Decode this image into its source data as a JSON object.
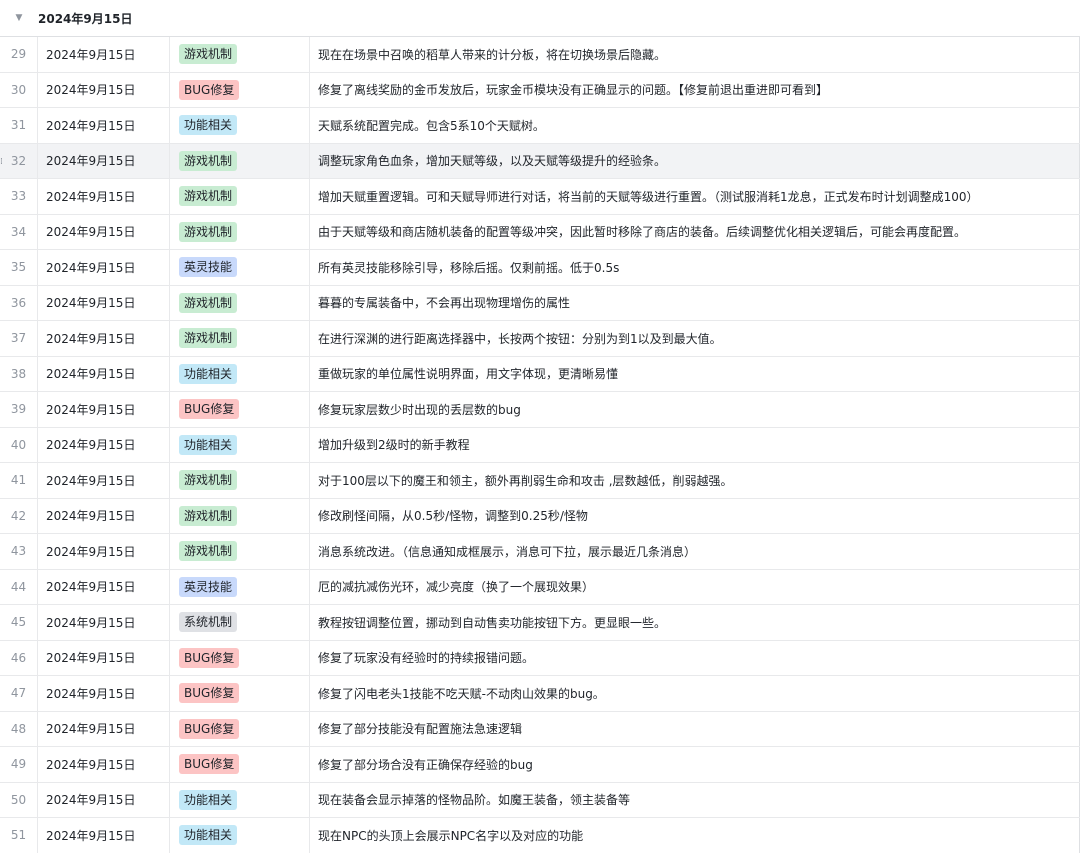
{
  "group": {
    "caret_icon": "▼",
    "title": "2024年9月15日"
  },
  "tag_colors": {
    "游戏机制": "#c8ecd2",
    "BUG修复": "#fcc4c4",
    "功能相关": "#c2e8f7",
    "英灵技能": "#c8d9fb",
    "系统机制": "#dfe1e5"
  },
  "rows": [
    {
      "num": "29",
      "date": "2024年9月15日",
      "tag": "游戏机制",
      "desc": "现在在场景中召唤的稻草人带来的计分板，将在切换场景后隐藏。"
    },
    {
      "num": "30",
      "date": "2024年9月15日",
      "tag": "BUG修复",
      "desc": "修复了离线奖励的金币发放后，玩家金币模块没有正确显示的问题。【修复前退出重进即可看到】"
    },
    {
      "num": "31",
      "date": "2024年9月15日",
      "tag": "功能相关",
      "desc": "天赋系统配置完成。包含5系10个天赋树。"
    },
    {
      "num": "32",
      "date": "2024年9月15日",
      "tag": "游戏机制",
      "desc": "调整玩家角色血条，增加天赋等级，以及天赋等级提升的经验条。",
      "highlight": true
    },
    {
      "num": "33",
      "date": "2024年9月15日",
      "tag": "游戏机制",
      "desc": "增加天赋重置逻辑。可和天赋导师进行对话，将当前的天赋等级进行重置。（测试服消耗1龙息，正式发布时计划调整成100）"
    },
    {
      "num": "34",
      "date": "2024年9月15日",
      "tag": "游戏机制",
      "desc": "由于天赋等级和商店随机装备的配置等级冲突，因此暂时移除了商店的装备。后续调整优化相关逻辑后，可能会再度配置。"
    },
    {
      "num": "35",
      "date": "2024年9月15日",
      "tag": "英灵技能",
      "desc": "所有英灵技能移除引导，移除后摇。仅剩前摇。低于0.5s"
    },
    {
      "num": "36",
      "date": "2024年9月15日",
      "tag": "游戏机制",
      "desc": "暮暮的专属装备中，不会再出现物理增伤的属性"
    },
    {
      "num": "37",
      "date": "2024年9月15日",
      "tag": "游戏机制",
      "desc": "在进行深渊的进行距离选择器中，长按两个按钮：分别为到1以及到最大值。"
    },
    {
      "num": "38",
      "date": "2024年9月15日",
      "tag": "功能相关",
      "desc": "重做玩家的单位属性说明界面，用文字体现，更清晰易懂"
    },
    {
      "num": "39",
      "date": "2024年9月15日",
      "tag": "BUG修复",
      "desc": "修复玩家层数少时出现的丢层数的bug"
    },
    {
      "num": "40",
      "date": "2024年9月15日",
      "tag": "功能相关",
      "desc": "增加升级到2级时的新手教程"
    },
    {
      "num": "41",
      "date": "2024年9月15日",
      "tag": "游戏机制",
      "desc": "对于100层以下的魔王和领主，额外再削弱生命和攻击 ,层数越低，削弱越强。"
    },
    {
      "num": "42",
      "date": "2024年9月15日",
      "tag": "游戏机制",
      "desc": "修改刷怪间隔，从0.5秒/怪物，调整到0.25秒/怪物"
    },
    {
      "num": "43",
      "date": "2024年9月15日",
      "tag": "游戏机制",
      "desc": "消息系统改进。（信息通知成框展示，消息可下拉，展示最近几条消息）"
    },
    {
      "num": "44",
      "date": "2024年9月15日",
      "tag": "英灵技能",
      "desc": "厄的减抗减伤光环，减少亮度（换了一个展现效果）"
    },
    {
      "num": "45",
      "date": "2024年9月15日",
      "tag": "系统机制",
      "desc": "教程按钮调整位置，挪动到自动售卖功能按钮下方。更显眼一些。"
    },
    {
      "num": "46",
      "date": "2024年9月15日",
      "tag": "BUG修复",
      "desc": "修复了玩家没有经验时的持续报错问题。"
    },
    {
      "num": "47",
      "date": "2024年9月15日",
      "tag": "BUG修复",
      "desc": "修复了闪电老头1技能不吃天赋-不动肉山效果的bug。"
    },
    {
      "num": "48",
      "date": "2024年9月15日",
      "tag": "BUG修复",
      "desc": "修复了部分技能没有配置施法急速逻辑"
    },
    {
      "num": "49",
      "date": "2024年9月15日",
      "tag": "BUG修复",
      "desc": "修复了部分场合没有正确保存经验的bug"
    },
    {
      "num": "50",
      "date": "2024年9月15日",
      "tag": "功能相关",
      "desc": "现在装备会显示掉落的怪物品阶。如魔王装备，领主装备等"
    },
    {
      "num": "51",
      "date": "2024年9月15日",
      "tag": "功能相关",
      "desc": "现在NPC的头顶上会展示NPC名字以及对应的功能"
    }
  ]
}
